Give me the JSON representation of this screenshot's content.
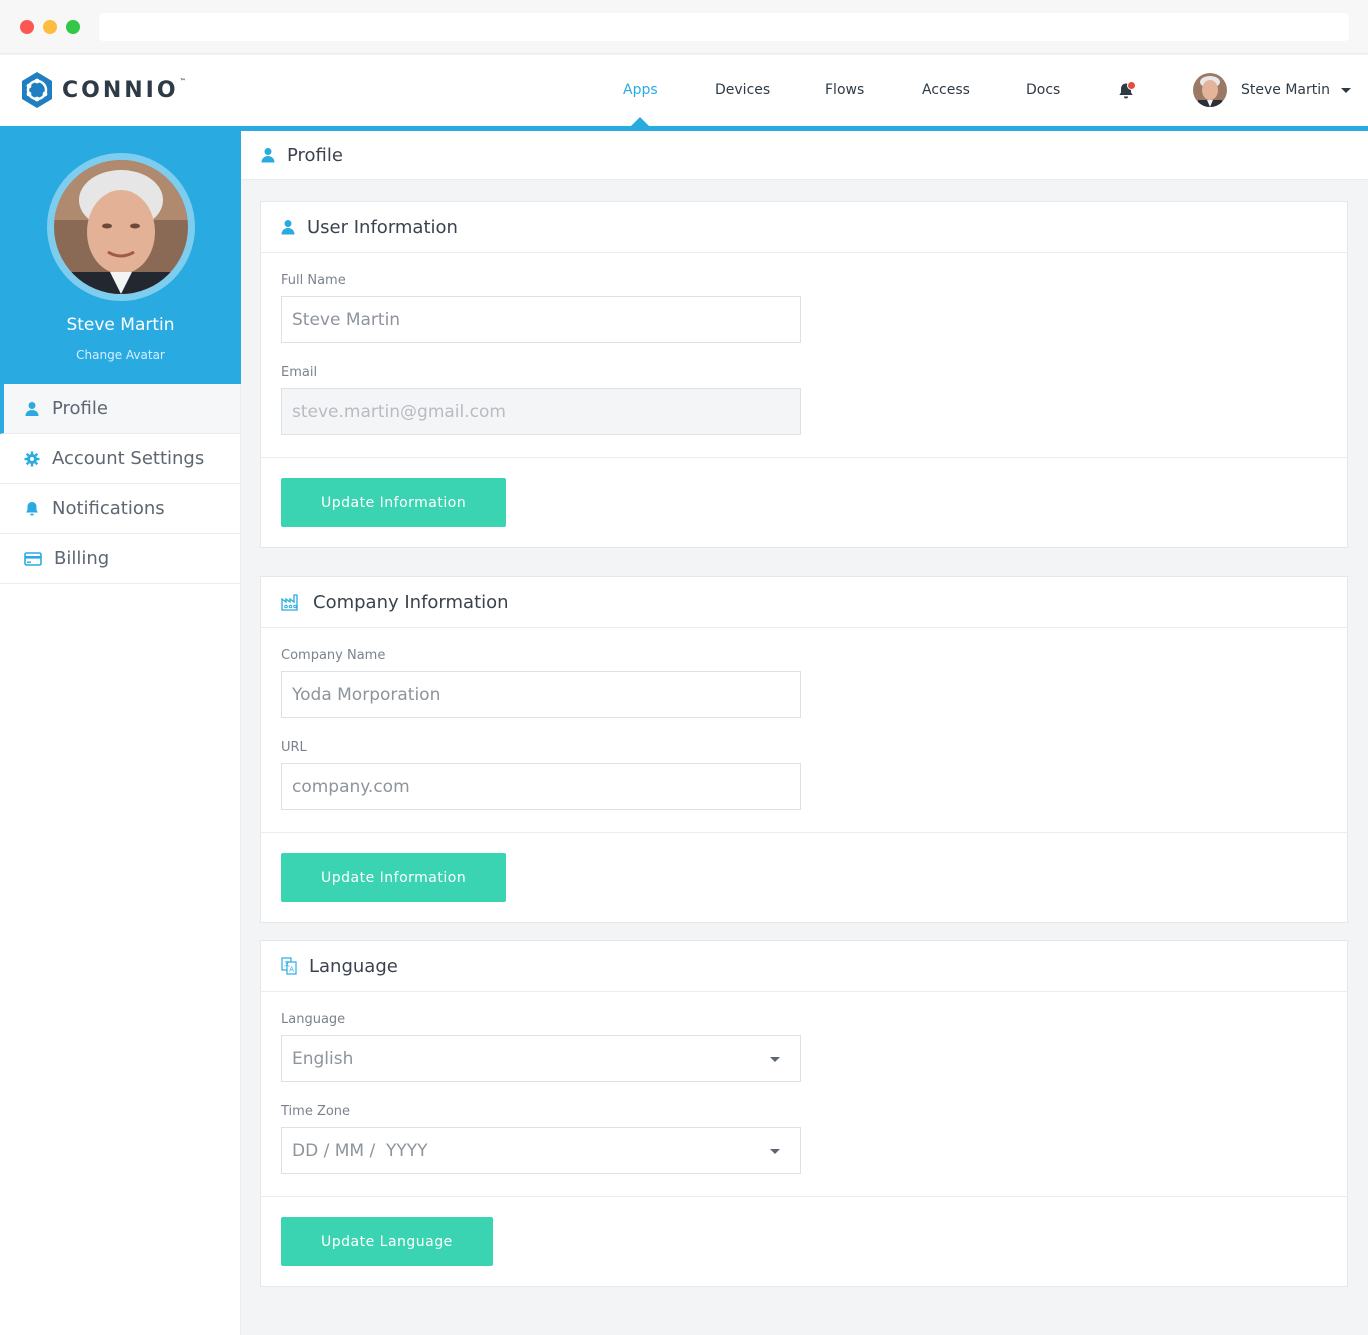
{
  "app": {
    "logo_text": "CONNIO",
    "logo_tm": "™"
  },
  "nav": {
    "items": [
      {
        "label": "Apps",
        "active": true
      },
      {
        "label": "Devices",
        "active": false
      },
      {
        "label": "Flows",
        "active": false
      },
      {
        "label": "Access",
        "active": false
      },
      {
        "label": "Docs",
        "active": false
      }
    ],
    "user_name": "Steve Martin"
  },
  "sidebar": {
    "user_name": "Steve Martin",
    "change_avatar": "Change Avatar",
    "items": [
      {
        "label": "Profile",
        "icon": "user-icon",
        "active": true
      },
      {
        "label": "Account Settings",
        "icon": "gear-icon",
        "active": false
      },
      {
        "label": "Notifications",
        "icon": "bell-icon",
        "active": false
      },
      {
        "label": "Billing",
        "icon": "credit-card-icon",
        "active": false
      }
    ]
  },
  "page": {
    "title": "Profile"
  },
  "user_info": {
    "title": "User Information",
    "full_name_label": "Full Name",
    "full_name_value": "Steve Martin",
    "email_label": "Email",
    "email_placeholder": "steve.martin@gmail.com",
    "button": "Update Information"
  },
  "company_info": {
    "title": "Company Information",
    "name_label": "Company Name",
    "name_placeholder": "Yoda Morporation",
    "url_label": "URL",
    "url_placeholder": "company.com",
    "button": "Update Information"
  },
  "language": {
    "title": "Language",
    "language_label": "Language",
    "language_value": "English",
    "timezone_label": "Time Zone",
    "timezone_value": "DD / MM /  YYYY",
    "button": "Update Language"
  },
  "colors": {
    "accent": "#29abe2",
    "button": "#3bd4b3",
    "badge": "#e74c3c"
  }
}
